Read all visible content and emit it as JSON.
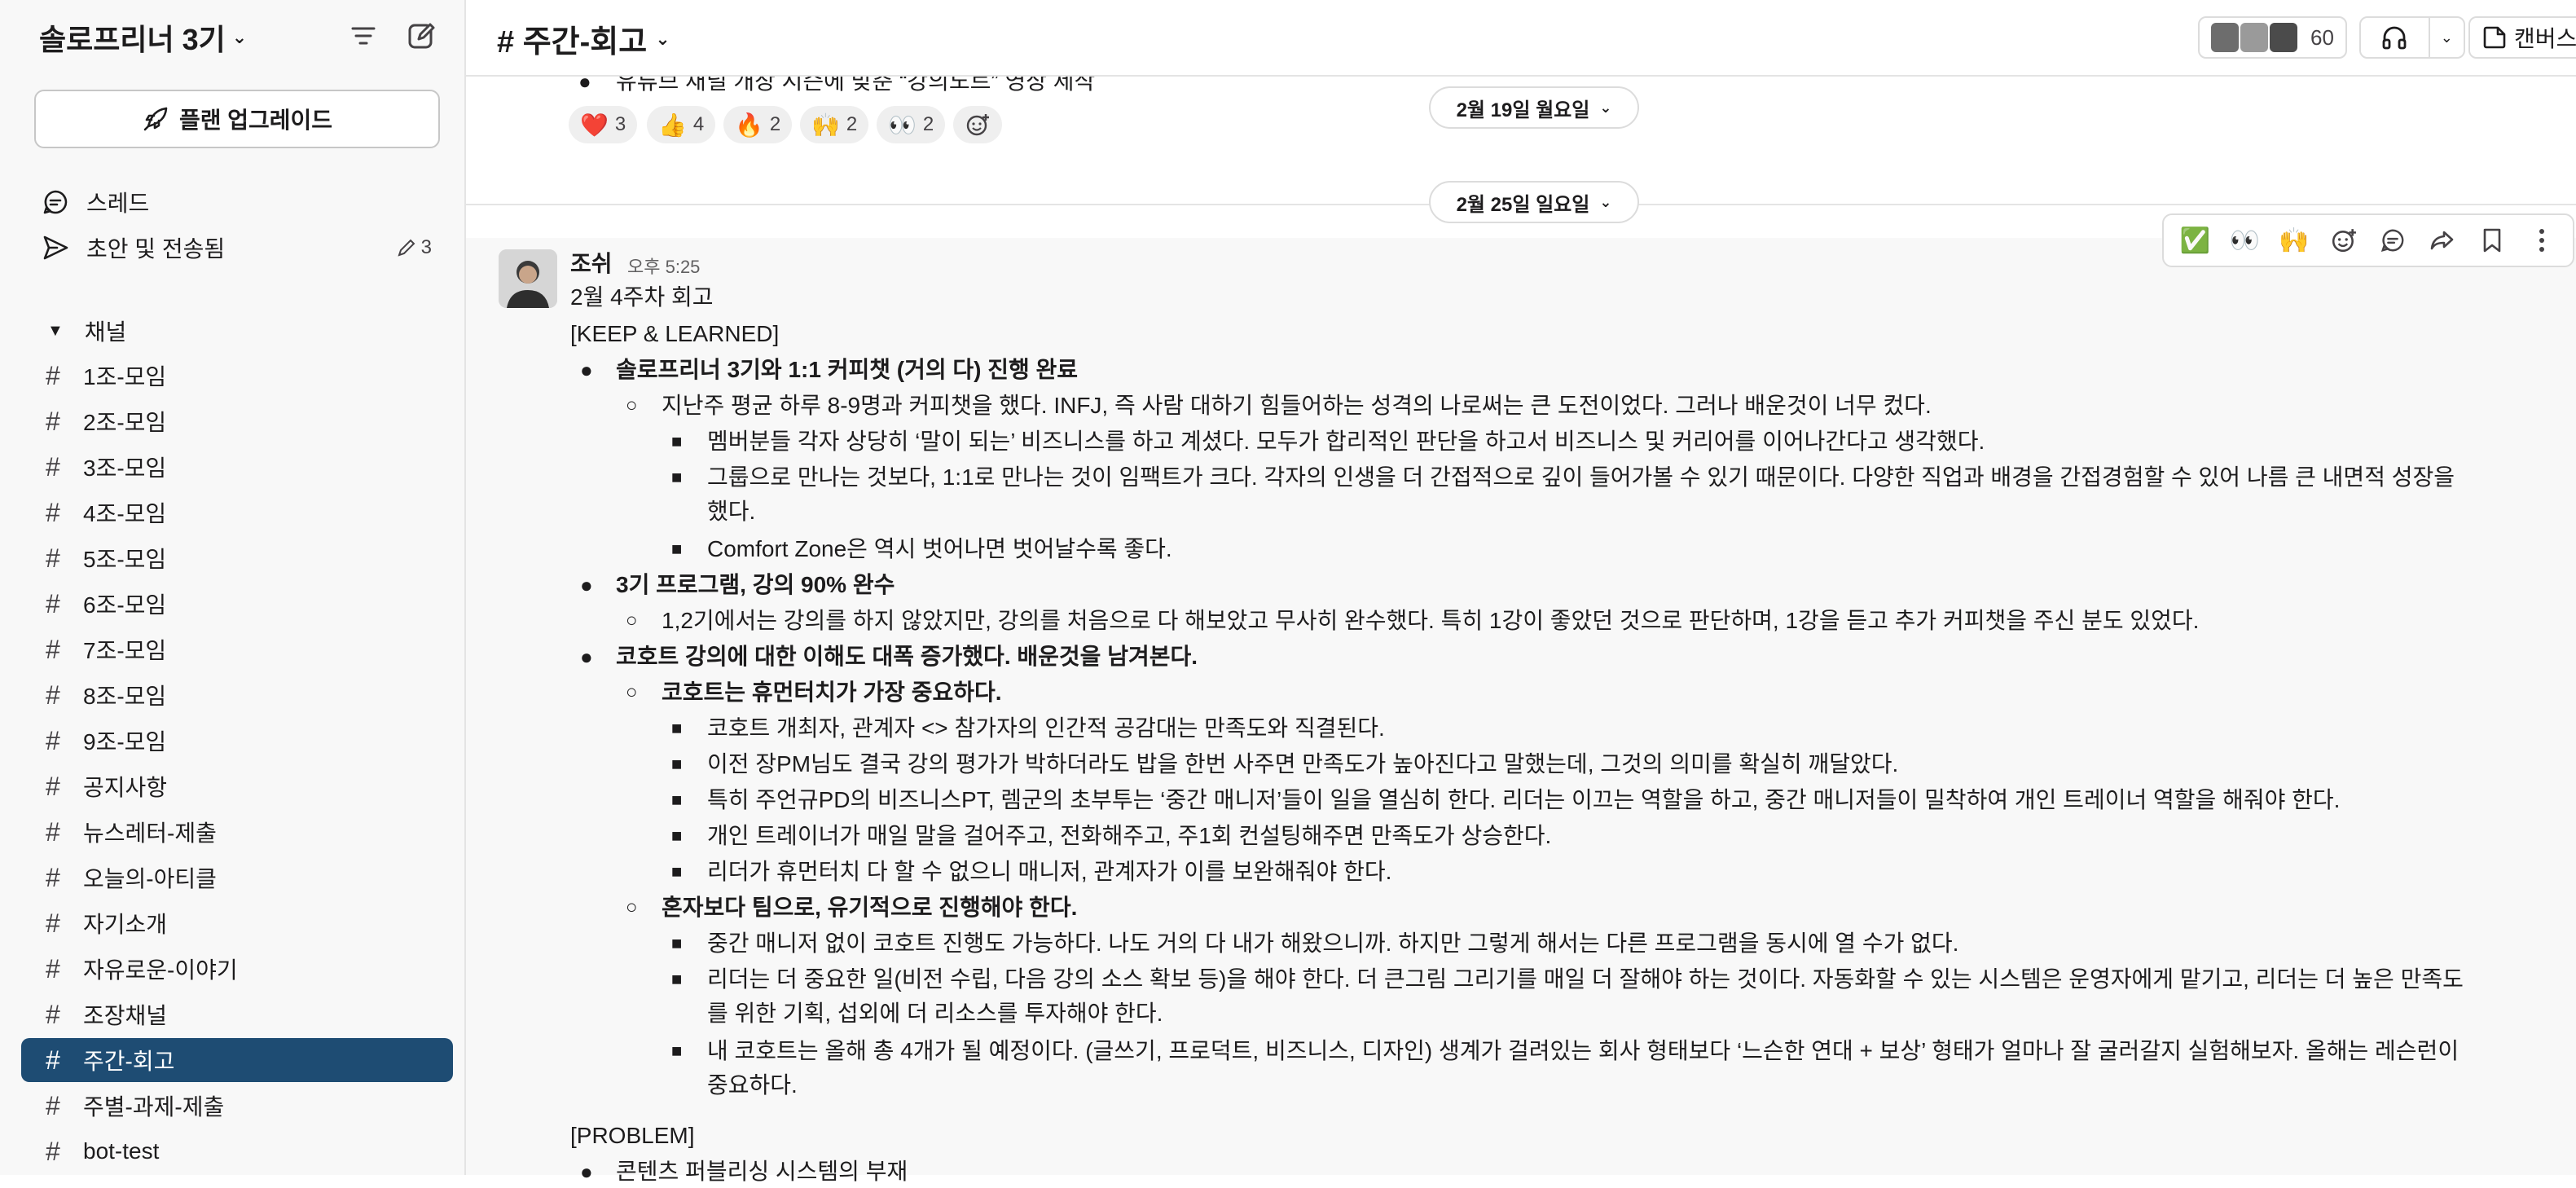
{
  "workspace": {
    "name": "솔로프리너 3기"
  },
  "sidebar": {
    "upgrade_label": "플랜 업그레이드",
    "threads_label": "스레드",
    "drafts_label": "초안 및 전송됨",
    "drafts_count": "3",
    "channels_section": "채널",
    "channels": [
      {
        "name": "1조-모임"
      },
      {
        "name": "2조-모임"
      },
      {
        "name": "3조-모임"
      },
      {
        "name": "4조-모임"
      },
      {
        "name": "5조-모임"
      },
      {
        "name": "6조-모임"
      },
      {
        "name": "7조-모임"
      },
      {
        "name": "8조-모임"
      },
      {
        "name": "9조-모임"
      },
      {
        "name": "공지사항"
      },
      {
        "name": "뉴스레터-제출"
      },
      {
        "name": "오늘의-아티클"
      },
      {
        "name": "자기소개"
      },
      {
        "name": "자유로운-이야기"
      },
      {
        "name": "조장채널"
      },
      {
        "name": "주간-회고"
      },
      {
        "name": "주별-과제-제출"
      },
      {
        "name": "bot-test"
      }
    ]
  },
  "header": {
    "channel_title": "# 주간-회고",
    "member_count": "60",
    "canvas_label": "캔버스"
  },
  "prev_message": {
    "last_line": "유튜브 채널 개장 시즌에 맞춘 “강의노트” 영상 제작",
    "reactions": [
      {
        "emoji": "❤️",
        "count": "3"
      },
      {
        "emoji": "👍",
        "count": "4"
      },
      {
        "emoji": "🔥",
        "count": "2"
      },
      {
        "emoji": "🙌",
        "count": "2"
      },
      {
        "emoji": "👀",
        "count": "2"
      }
    ]
  },
  "dates": {
    "first": "2월 19일 월요일",
    "second": "2월 25일 일요일"
  },
  "toolbar": {
    "emojis": [
      "✅",
      "👀",
      "🙌"
    ]
  },
  "message": {
    "author": "조쉬",
    "time": "오후 5:25",
    "lines": [
      "2월 4주차 회고",
      "[KEEP & LEARNED]",
      "솔로프리너 3기와 1:1 커피챗 (거의 다) 진행 완료",
      "지난주 평균 하루 8-9명과 커피챗을 했다. INFJ, 즉 사람 대하기 힘들어하는 성격의 나로써는 큰 도전이었다. 그러나 배운것이 너무 컸다.",
      "멤버분들 각자 상당히 ‘말이 되는’ 비즈니스를 하고 계셨다. 모두가 합리적인 판단을 하고서 비즈니스 및 커리어를 이어나간다고 생각했다.",
      "그룹으로 만나는 것보다, 1:1로 만나는 것이 임팩트가 크다. 각자의 인생을 더 간접적으로 깊이 들어가볼 수 있기 때문이다. 다양한 직업과 배경을 간접경험할 수 있어 나름 큰 내면적 성장을",
      "했다.",
      "Comfort Zone은 역시 벗어나면 벗어날수록 좋다.",
      "3기 프로그램, 강의 90% 완수",
      "1,2기에서는 강의를 하지 않았지만, 강의를 처음으로 다 해보았고 무사히 완수했다. 특히 1강이 좋았던 것으로 판단하며, 1강을 듣고 추가 커피챗을 주신 분도 있었다.",
      "코호트 강의에 대한 이해도 대폭 증가했다. 배운것을 남겨본다.",
      "코호트는 휴먼터치가 가장 중요하다.",
      "코호트 개최자, 관계자 <> 참가자의 인간적 공감대는 만족도와 직결된다.",
      "이전 장PM님도 결국 강의 평가가 박하더라도 밥을 한번 사주면 만족도가 높아진다고 말했는데, 그것의 의미를 확실히 깨달았다.",
      "특히 주언규PD의 비즈니스PT, 렘군의 초부투는 ‘중간 매니저’들이 일을 열심히 한다. 리더는 이끄는 역할을 하고, 중간 매니저들이 밀착하여 개인 트레이너 역할을 해줘야 한다.",
      "개인 트레이너가 매일 말을 걸어주고, 전화해주고, 주1회 컨설팅해주면 만족도가 상승한다.",
      "리더가 휴먼터치 다 할 수 없으니 매니저, 관계자가 이를 보완해줘야 한다.",
      "혼자보다 팀으로, 유기적으로 진행해야 한다.",
      "중간 매니저 없이 코호트 진행도 가능하다. 나도 거의 다 내가 해왔으니까. 하지만 그렇게 해서는 다른 프로그램을 동시에 열 수가 없다.",
      "리더는 더 중요한 일(비전 수립, 다음 강의 소스 확보 등)을 해야 한다. 더 큰그림 그리기를 매일 더 잘해야 하는 것이다. 자동화할 수 있는 시스템은 운영자에게 맡기고, 리더는 더 높은 만족도",
      "를 위한 기획, 섭외에 더 리소스를 투자해야 한다.",
      "내 코호트는 올해 총 4개가 될 예정이다. (글쓰기, 프로덕트, 비즈니스, 디자인) 생계가 걸려있는 회사 형태보다 ‘느슨한 연대 + 보상’ 형태가 얼마나 잘 굴러갈지 실험해보자. 올해는 레슨런이",
      "중요하다.",
      "[PROBLEM]",
      "콘텐츠 퍼블리싱 시스템의 부재"
    ]
  }
}
